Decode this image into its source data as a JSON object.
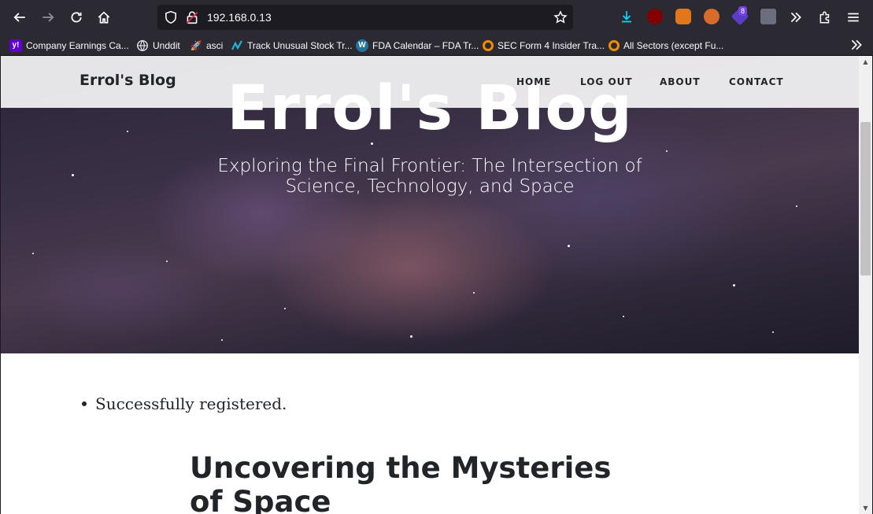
{
  "browser": {
    "url": "192.168.0.13",
    "extension_badge": "8",
    "bookmarks": [
      {
        "label": "Company Earnings Ca...",
        "icon": "yahoo-icon",
        "color": "#6001d2",
        "glyph": "y!"
      },
      {
        "label": "Unddit",
        "icon": "globe-icon",
        "color": "#2b2a33",
        "glyph": ""
      },
      {
        "label": "asci",
        "icon": "rocket-icon",
        "color": "#2b2a33",
        "glyph": "🚀"
      },
      {
        "label": "Track Unusual Stock Tr...",
        "icon": "chart-logo-icon",
        "color": "#2b2a33",
        "glyph": ""
      },
      {
        "label": "FDA Calendar – FDA Tr...",
        "icon": "wordpress-icon",
        "color": "#21759b",
        "glyph": "W"
      },
      {
        "label": "SEC Form 4 Insider Tra...",
        "icon": "orange-circle-icon",
        "color": "#f28c00",
        "glyph": ""
      },
      {
        "label": "All Sectors (except Fu...",
        "icon": "orange-circle-icon",
        "color": "#f28c00",
        "glyph": ""
      }
    ]
  },
  "page": {
    "brand": "Errol's Blog",
    "nav": [
      "HOME",
      "LOG OUT",
      "ABOUT",
      "CONTACT"
    ],
    "hero_title": "Errol's Blog",
    "hero_subtitle": "Exploring the Final Frontier: The Intersection of Science, Technology, and Space",
    "messages": [
      "Successfully registered."
    ],
    "post_title": "Uncovering the Mysteries of Space"
  }
}
